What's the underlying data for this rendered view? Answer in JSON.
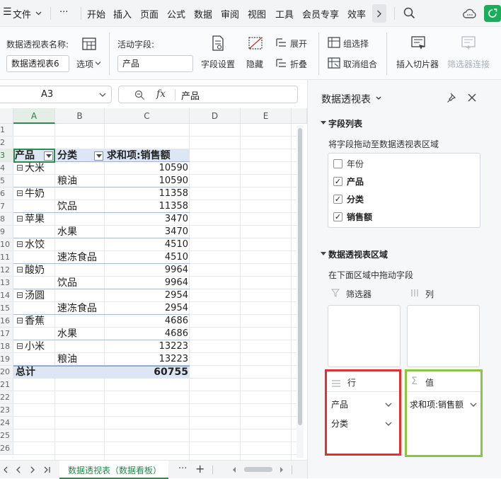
{
  "menubar": {
    "menu_icon": "☰",
    "file": "文件",
    "more": "···",
    "tabs": [
      "开始",
      "插入",
      "页面",
      "公式",
      "数据",
      "审阅",
      "视图",
      "工具",
      "会员专享",
      "效率"
    ],
    "next": "›"
  },
  "ribbon": {
    "pivot_name_label": "数据透视表名称:",
    "pivot_name_value": "数据透视表6",
    "options": "选项",
    "active_field_label": "活动字段:",
    "active_field_value": "产品",
    "field_settings": "字段设置",
    "hide": "隐藏",
    "expand": "展开",
    "collapse": "折叠",
    "group_selection": "组选择",
    "ungroup": "取消组合",
    "insert_slicer": "插入切片器",
    "filter_connection": "筛选器连接"
  },
  "formula_bar": {
    "name_box": "A3",
    "fx": "fx",
    "content": "产品"
  },
  "grid": {
    "columns": [
      "A",
      "B",
      "C",
      "D",
      "E"
    ],
    "rows": [
      "1",
      "2",
      "3",
      "4",
      "5",
      "6",
      "7",
      "8",
      "9",
      "10",
      "11",
      "12",
      "13",
      "14",
      "15",
      "16",
      "17",
      "18",
      "19",
      "20",
      "21",
      "22",
      "23",
      "24",
      "25",
      "26"
    ],
    "header": {
      "product": "产品",
      "category": "分类",
      "sum_label": "求和项:销售额"
    },
    "data_rows": [
      {
        "product": "大米",
        "category": "",
        "value": "10590",
        "expand": "⊟"
      },
      {
        "product": "",
        "category": "粮油",
        "value": "10590",
        "expand": ""
      },
      {
        "product": "牛奶",
        "category": "",
        "value": "11358",
        "expand": "⊟"
      },
      {
        "product": "",
        "category": "饮品",
        "value": "11358",
        "expand": ""
      },
      {
        "product": "苹果",
        "category": "",
        "value": "3470",
        "expand": "⊟"
      },
      {
        "product": "",
        "category": "水果",
        "value": "3470",
        "expand": ""
      },
      {
        "product": "水饺",
        "category": "",
        "value": "4510",
        "expand": "⊟"
      },
      {
        "product": "",
        "category": "速冻食品",
        "value": "4510",
        "expand": ""
      },
      {
        "product": "酸奶",
        "category": "",
        "value": "9964",
        "expand": "⊟"
      },
      {
        "product": "",
        "category": "饮品",
        "value": "9964",
        "expand": ""
      },
      {
        "product": "汤圆",
        "category": "",
        "value": "2954",
        "expand": "⊟"
      },
      {
        "product": "",
        "category": "速冻食品",
        "value": "2954",
        "expand": ""
      },
      {
        "product": "香蕉",
        "category": "",
        "value": "4686",
        "expand": "⊟"
      },
      {
        "product": "",
        "category": "水果",
        "value": "4686",
        "expand": ""
      },
      {
        "product": "小米",
        "category": "",
        "value": "13223",
        "expand": "⊟"
      },
      {
        "product": "",
        "category": "粮油",
        "value": "13223",
        "expand": ""
      }
    ],
    "total": {
      "label": "总计",
      "value": "60755"
    }
  },
  "sheet_tabs": {
    "active": "数据透视表（数据看板）",
    "more": "···",
    "add": "+"
  },
  "pane": {
    "title": "数据透视表",
    "field_list_title": "字段列表",
    "drag_hint": "将字段拖动至数据透视表区域",
    "fields": [
      {
        "name": "年份",
        "checked": false
      },
      {
        "name": "产品",
        "checked": true
      },
      {
        "name": "分类",
        "checked": true
      },
      {
        "name": "销售额",
        "checked": true
      }
    ],
    "area_title": "数据透视表区域",
    "area_hint": "在下面区域中拖动字段",
    "filter_label": "筛选器",
    "column_label": "列",
    "row_label": "行",
    "value_label": "值",
    "row_fields": [
      "产品",
      "分类"
    ],
    "value_fields": [
      "求和项:销售额"
    ],
    "highlight_colors": {
      "row": "#e03030",
      "value": "#8cc63f"
    }
  }
}
